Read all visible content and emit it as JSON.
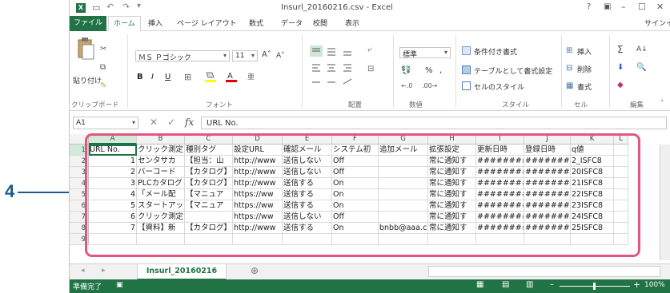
{
  "window": {
    "title": "Insurl_20160216.csv - Excel",
    "controls": [
      "?",
      "▣",
      "–",
      "☐",
      "✕"
    ]
  },
  "ribbon_tabs": [
    "ファイル",
    "ホーム",
    "挿入",
    "ページ レイアウト",
    "数式",
    "データ",
    "校閲",
    "表示"
  ],
  "signin": "サインイ",
  "ribbon": {
    "clipboard": {
      "paste": "貼り付け",
      "label": "クリップボード"
    },
    "font": {
      "name": "ＭＳ Ｐゴシック",
      "size": "11",
      "label": "フォント",
      "bold": "B",
      "italic": "I",
      "underline": "U"
    },
    "alignment": {
      "label": "配置"
    },
    "number": {
      "format": "標準",
      "label": "数値",
      "percent": "%",
      "comma": ","
    },
    "styles": {
      "conditional": "条件付き書式",
      "table": "テーブルとして書式設定",
      "cell_styles": "セルのスタイル",
      "label": "スタイル"
    },
    "cells": {
      "insert": "挿入",
      "delete": "削除",
      "format": "書式",
      "label": "セル"
    },
    "editing": {
      "label": "編集"
    }
  },
  "formula_bar": {
    "name_box": "A1",
    "fx": "fx",
    "value": "URL No."
  },
  "grid": {
    "columns": [
      "A",
      "B",
      "C",
      "D",
      "E",
      "F",
      "G",
      "H",
      "I",
      "J",
      "K",
      "L"
    ],
    "rows": [
      "1",
      "2",
      "3",
      "4",
      "5",
      "6",
      "7",
      "8",
      "9"
    ],
    "cells": [
      [
        "URL No.",
        "クリック測定",
        "種別タグ",
        "設定URL",
        "確認メール",
        "システム初",
        "追加メール",
        "拡張設定",
        "更新日時",
        "登録日時",
        "q値"
      ],
      [
        "1",
        "センタサカ",
        "【担当：山",
        "http://www",
        "送信しない",
        "Off",
        "",
        "常に通知す",
        "########",
        "########",
        "2_ISFC8"
      ],
      [
        "2",
        "バーコード",
        "【カタログ】",
        "http://www",
        "送信しない",
        "Off",
        "",
        "常に通知す",
        "########",
        "########",
        "20ISFC8"
      ],
      [
        "3",
        "PLCカタログ",
        "【カタログ】",
        "http://www",
        "送信する",
        "On",
        "",
        "常に通知す",
        "########",
        "########",
        "21ISFC8"
      ],
      [
        "4",
        "「メール配",
        "【マニュア",
        "https://ww",
        "送信する",
        "On",
        "",
        "常に通知す",
        "########",
        "########",
        "22ISFC8"
      ],
      [
        "5",
        "スタートアッ",
        "【マニュア",
        "https://ww",
        "送信する",
        "On",
        "",
        "常に通知す",
        "########",
        "########",
        "23ISFC8"
      ],
      [
        "6",
        "クリック測定",
        "",
        "https://ww",
        "送信しない",
        "Off",
        "",
        "常に通知す",
        "########",
        "########",
        "24ISFC8"
      ],
      [
        "7",
        "【資料】新",
        "【カタログ】",
        "http://www",
        "送信する",
        "On",
        "bnbb@aaa.c",
        "常に通知す",
        "########",
        "########",
        "25ISFC8"
      ],
      [
        "",
        "",
        "",
        "",
        "",
        "",
        "",
        "",
        "",
        "",
        ""
      ]
    ]
  },
  "sheet_tab": "Insurl_20160216",
  "status": {
    "ready": "準備完了",
    "zoom": "100%"
  },
  "callout": "4",
  "colors": {
    "excel_green": "#217346",
    "highlight": "#e4567b",
    "callout": "#1e5a8c"
  }
}
